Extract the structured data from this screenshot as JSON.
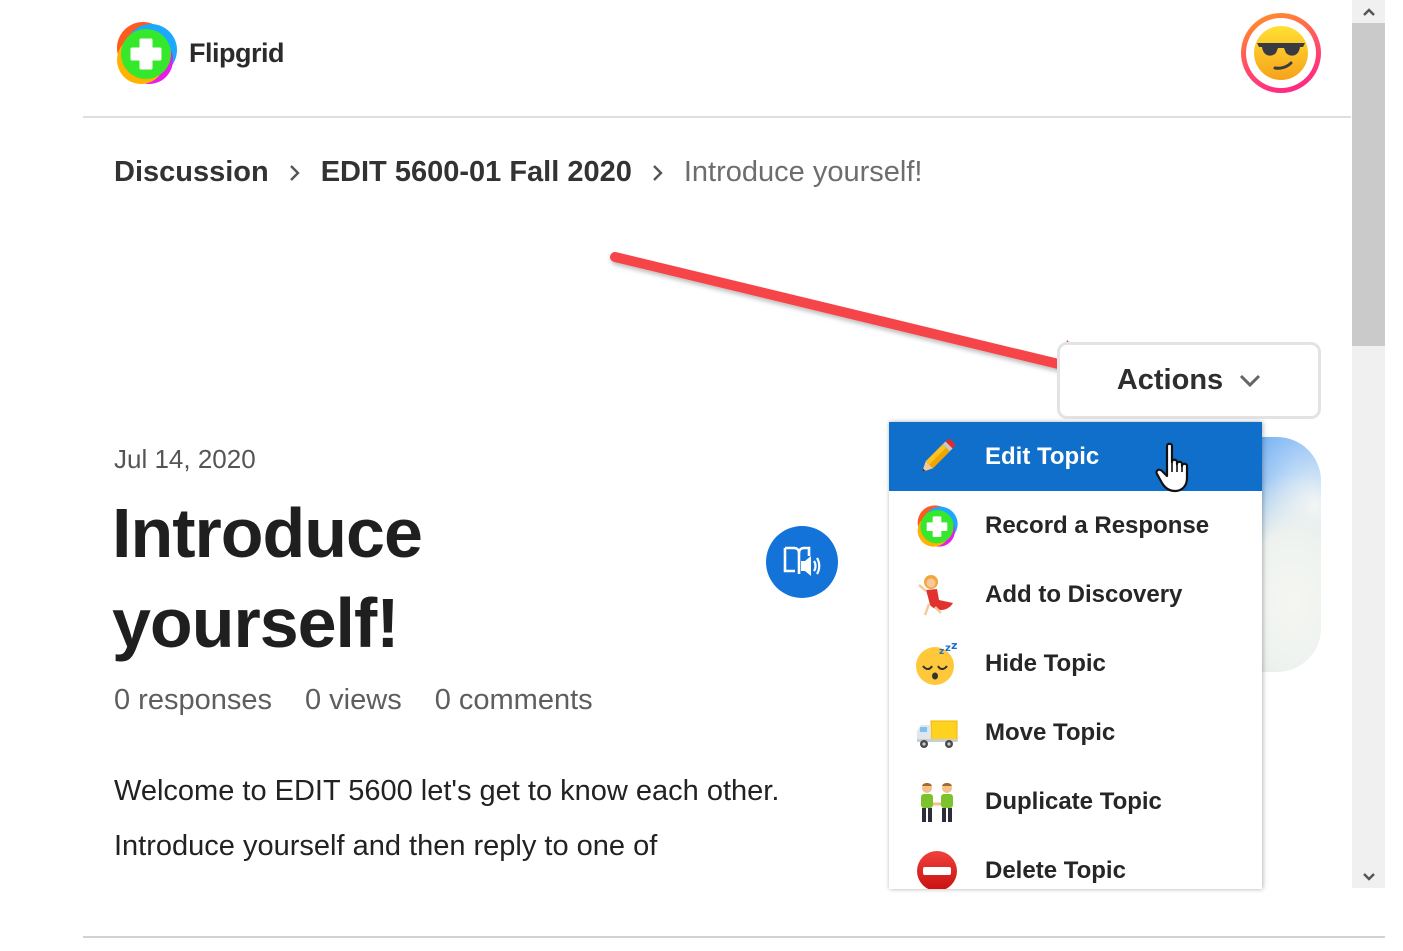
{
  "app": {
    "name": "Flipgrid"
  },
  "colors": {
    "accent": "#0f6fcb",
    "annotation": "#f5444a",
    "immersive": "#1473d8"
  },
  "header": {
    "logo_text": "Flipgrid",
    "avatar_icon": "sunglasses-face-emoji"
  },
  "breadcrumb": [
    {
      "label": "Discussion"
    },
    {
      "label": "EDIT 5600-01 Fall 2020"
    },
    {
      "label": "Introduce yourself!"
    }
  ],
  "actions": {
    "label": "Actions",
    "icon": "chevron-down-icon"
  },
  "topic": {
    "date": "Jul 14, 2020",
    "title_line1": "Introduce",
    "title_line2": "yourself!",
    "stats": {
      "responses": "0 responses",
      "views": "0 views",
      "comments": "0 comments"
    },
    "description": "Welcome to EDIT 5600 let's get to know each other. Introduce yourself and then reply to one of"
  },
  "menu": {
    "items": [
      {
        "label": "Edit Topic",
        "icon": "pencil-icon",
        "active": true
      },
      {
        "label": "Record a Response",
        "icon": "flipgrid-record-icon",
        "active": false
      },
      {
        "label": "Add to Discovery",
        "icon": "dancer-icon",
        "active": false
      },
      {
        "label": "Hide Topic",
        "icon": "sleeping-face-icon",
        "active": false
      },
      {
        "label": "Move Topic",
        "icon": "truck-icon",
        "active": false
      },
      {
        "label": "Duplicate Topic",
        "icon": "twins-icon",
        "active": false
      },
      {
        "label": "Delete Topic",
        "icon": "no-entry-icon",
        "active": false
      }
    ]
  }
}
